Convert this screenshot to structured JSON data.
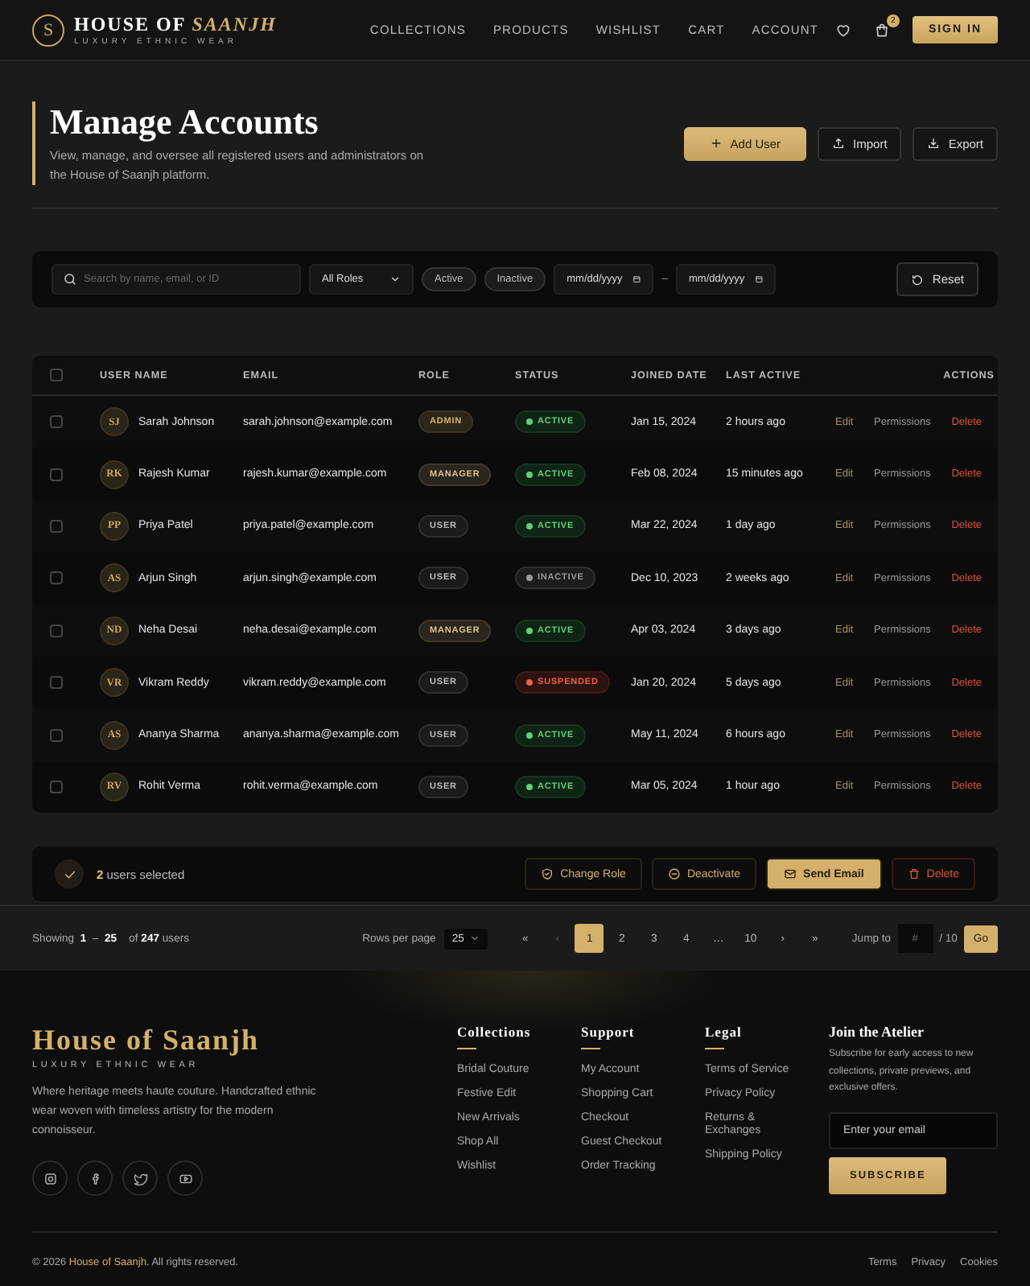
{
  "header": {
    "logo_letter": "S",
    "brand_main": "HOUSE OF",
    "brand_accent": "SAANJH",
    "tagline": "LUXURY ETHNIC WEAR",
    "nav": [
      "COLLECTIONS",
      "PRODUCTS",
      "WISHLIST",
      "CART",
      "ACCOUNT"
    ],
    "cart_count": "2",
    "sign_in": "SIGN IN"
  },
  "page": {
    "title": "Manage Accounts",
    "subtitle": "View, manage, and oversee all registered users and administrators on the House of Saanjh platform.",
    "actions": [
      {
        "label": "Add User",
        "kind": "primary"
      },
      {
        "label": "Import",
        "kind": "import"
      },
      {
        "label": "Export",
        "kind": "export"
      }
    ]
  },
  "filters": {
    "search_placeholder": "Search by name, email, or ID",
    "role": "All Roles",
    "status_chips": [
      {
        "label": "Active",
        "selected": false
      },
      {
        "label": "Inactive",
        "selected": false
      }
    ],
    "date_from": "mm/dd/yyyy",
    "date_sep": "–",
    "date_to": "mm/dd/yyyy",
    "reset": "Reset"
  },
  "table": {
    "select_all_checked": false,
    "columns": [
      "USER NAME",
      "EMAIL",
      "ROLE",
      "STATUS",
      "JOINED DATE",
      "LAST ACTIVE",
      "ACTIONS"
    ],
    "rows": [
      {
        "initials": "SJ",
        "name": "Sarah Johnson",
        "email": "sarah.johnson@example.com",
        "role": {
          "label": "ADMIN",
          "kind": "admin"
        },
        "status": {
          "label": "ACTIVE",
          "kind": "active"
        },
        "joined": "Jan 15, 2024",
        "last_active": "2 hours ago",
        "checked": false,
        "actions": [
          "Edit",
          "Permissions",
          "Delete"
        ]
      },
      {
        "initials": "RK",
        "name": "Rajesh Kumar",
        "email": "rajesh.kumar@example.com",
        "role": {
          "label": "MANAGER",
          "kind": "manager"
        },
        "status": {
          "label": "ACTIVE",
          "kind": "active"
        },
        "joined": "Feb 08, 2024",
        "last_active": "15 minutes ago",
        "checked": false,
        "actions": [
          "Edit",
          "Permissions",
          "Delete"
        ]
      },
      {
        "initials": "PP",
        "name": "Priya Patel",
        "email": "priya.patel@example.com",
        "role": {
          "label": "USER",
          "kind": "user"
        },
        "status": {
          "label": "ACTIVE",
          "kind": "active"
        },
        "joined": "Mar 22, 2024",
        "last_active": "1 day ago",
        "checked": false,
        "actions": [
          "Edit",
          "Permissions",
          "Delete"
        ]
      },
      {
        "initials": "AS",
        "name": "Arjun Singh",
        "email": "arjun.singh@example.com",
        "role": {
          "label": "USER",
          "kind": "user"
        },
        "status": {
          "label": "INACTIVE",
          "kind": "inactive"
        },
        "joined": "Dec 10, 2023",
        "last_active": "2 weeks ago",
        "checked": false,
        "actions": [
          "Edit",
          "Permissions",
          "Delete"
        ]
      },
      {
        "initials": "ND",
        "name": "Neha Desai",
        "email": "neha.desai@example.com",
        "role": {
          "label": "MANAGER",
          "kind": "manager"
        },
        "status": {
          "label": "ACTIVE",
          "kind": "active"
        },
        "joined": "Apr 03, 2024",
        "last_active": "3 days ago",
        "checked": false,
        "actions": [
          "Edit",
          "Permissions",
          "Delete"
        ]
      },
      {
        "initials": "VR",
        "name": "Vikram Reddy",
        "email": "vikram.reddy@example.com",
        "role": {
          "label": "USER",
          "kind": "user"
        },
        "status": {
          "label": "SUSPENDED",
          "kind": "suspended"
        },
        "joined": "Jan 20, 2024",
        "last_active": "5 days ago",
        "checked": false,
        "actions": [
          "Edit",
          "Permissions",
          "Delete"
        ]
      },
      {
        "initials": "AS",
        "name": "Ananya Sharma",
        "email": "ananya.sharma@example.com",
        "role": {
          "label": "USER",
          "kind": "user"
        },
        "status": {
          "label": "ACTIVE",
          "kind": "active"
        },
        "joined": "May 11, 2024",
        "last_active": "6 hours ago",
        "checked": false,
        "actions": [
          "Edit",
          "Permissions",
          "Delete"
        ]
      },
      {
        "initials": "RV",
        "name": "Rohit Verma",
        "email": "rohit.verma@example.com",
        "role": {
          "label": "USER",
          "kind": "user"
        },
        "status": {
          "label": "ACTIVE",
          "kind": "active"
        },
        "joined": "Mar 05, 2024",
        "last_active": "1 hour ago",
        "checked": false,
        "actions": [
          "Edit",
          "Permissions",
          "Delete"
        ]
      }
    ]
  },
  "bulk": {
    "count": "2",
    "text": "users selected",
    "actions": [
      {
        "label": "Change Role",
        "kind": "role"
      },
      {
        "label": "Deactivate",
        "kind": "deactivate"
      },
      {
        "label": "Send Email",
        "kind": "email"
      },
      {
        "label": "Delete",
        "kind": "delete"
      }
    ]
  },
  "pagination": {
    "showing": "Showing",
    "from": "1",
    "dash": "–",
    "to": "25",
    "of": "of",
    "total": "247",
    "unit": "users",
    "rows_label": "Rows per page",
    "rows_value": "25",
    "first": "«",
    "prev": "‹",
    "pages": [
      {
        "label": "1",
        "selected": true
      },
      {
        "label": "2",
        "selected": false
      },
      {
        "label": "3",
        "selected": false
      },
      {
        "label": "4",
        "selected": false
      },
      {
        "label": "…",
        "selected": false
      },
      {
        "label": "10",
        "selected": false
      }
    ],
    "next": "›",
    "last": "»",
    "jump_label": "Jump to",
    "jump_placeholder": "#",
    "jump_total": "/ 10",
    "go": "Go"
  },
  "footer": {
    "brand": "House of Saanjh",
    "tagline": "LUXURY ETHNIC WEAR",
    "description": "Where heritage meets haute couture. Handcrafted ethnic wear woven with timeless artistry for the modern connoisseur.",
    "socials": [
      {
        "kind": "instagram"
      },
      {
        "kind": "facebook"
      },
      {
        "kind": "twitter"
      },
      {
        "kind": "youtube"
      }
    ],
    "columns": [
      {
        "title": "Collections",
        "links": [
          "Bridal Couture",
          "Festive Edit",
          "New Arrivals",
          "Shop All",
          "Wishlist"
        ]
      },
      {
        "title": "Support",
        "links": [
          "My Account",
          "Shopping Cart",
          "Checkout",
          "Guest Checkout",
          "Order Tracking"
        ]
      },
      {
        "title": "Legal",
        "links": [
          "Terms of Service",
          "Privacy Policy",
          "Returns & Exchanges",
          "Shipping Policy"
        ]
      }
    ],
    "newsletter": {
      "title": "Join the Atelier",
      "text": "Subscribe for early access to new collections, private previews, and exclusive offers.",
      "placeholder": "Enter your email",
      "button": "SUBSCRIBE"
    },
    "copyright_pre": "© 2026",
    "copyright_brand": "House of Saanjh",
    "copyright_post": ". All rights reserved.",
    "legal_links": [
      "Terms",
      "Privacy",
      "Cookies"
    ]
  }
}
